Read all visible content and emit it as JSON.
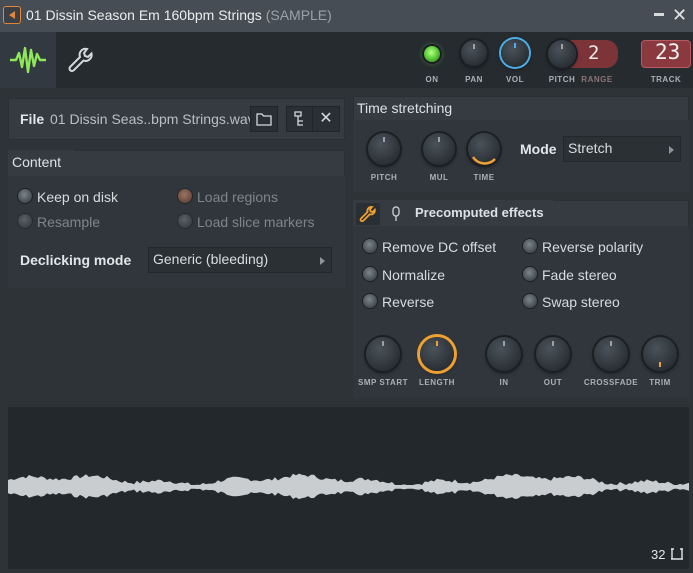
{
  "title": {
    "name": "01 Dissin Season Em 160bpm Strings",
    "suffix": "(SAMPLE)"
  },
  "header": {
    "knobs": {
      "on_label": "ON",
      "pan_label": "PAN",
      "vol_label": "VOL",
      "pitch_label": "PITCH",
      "range_label": "RANGE",
      "range_value": "2",
      "track_label": "TRACK",
      "track_value": "23"
    }
  },
  "file": {
    "label": "File",
    "name": "01 Dissin Seas..bpm Strings.wav"
  },
  "content": {
    "title": "Content",
    "keep_on_disk": "Keep on disk",
    "resample": "Resample",
    "load_regions": "Load regions",
    "load_slice_markers": "Load slice markers",
    "declicking_label": "Declicking mode",
    "declicking_value": "Generic (bleeding)"
  },
  "time_stretching": {
    "title": "Time stretching",
    "pitch_label": "PITCH",
    "mul_label": "MUL",
    "time_label": "TIME",
    "mode_label": "Mode",
    "mode_value": "Stretch"
  },
  "precomputed": {
    "title": "Precomputed effects",
    "effects": {
      "remove_dc": "Remove DC offset",
      "normalize": "Normalize",
      "reverse": "Reverse",
      "reverse_polarity": "Reverse polarity",
      "fade_stereo": "Fade stereo",
      "swap_stereo": "Swap stereo"
    },
    "knobs": {
      "smp_start": "SMP START",
      "length": "LENGTH",
      "in": "IN",
      "out": "OUT",
      "crossfade": "CROSSFADE",
      "trim": "TRIM"
    }
  },
  "waveform": {
    "counter": "32"
  },
  "colors": {
    "accent_orange": "#e2873a",
    "led_green": "#6cd048",
    "range_red": "#7d3439",
    "vol_ring_blue": "#4ab0e6"
  }
}
